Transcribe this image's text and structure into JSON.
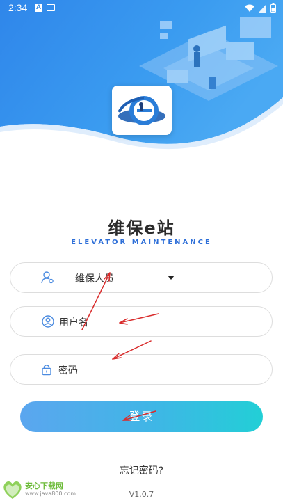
{
  "status": {
    "time": "2:34"
  },
  "app": {
    "title": "维保e站",
    "subtitle": "ELEVATOR MAINTENANCE"
  },
  "role_select": {
    "value": "维保人员"
  },
  "username": {
    "placeholder": "用户名"
  },
  "password": {
    "placeholder": "密码"
  },
  "login_label": "登录",
  "forgot_label": "忘记密码?",
  "version": "V1.0.7",
  "watermark": {
    "name": "安心下载网",
    "url": "www.java800.com",
    "badge": "绿色安全"
  },
  "colors": {
    "accent": "#2e6fd8",
    "button_start": "#5ba6ef",
    "button_end": "#22cfd6",
    "hero_top": "#2f86ea",
    "annotation": "#d92b2b"
  },
  "icons": [
    "wifi-icon",
    "signal-icon",
    "battery-icon",
    "person-gear-icon",
    "user-icon",
    "lock-icon",
    "dropdown-caret-icon",
    "app-logo-icon"
  ]
}
